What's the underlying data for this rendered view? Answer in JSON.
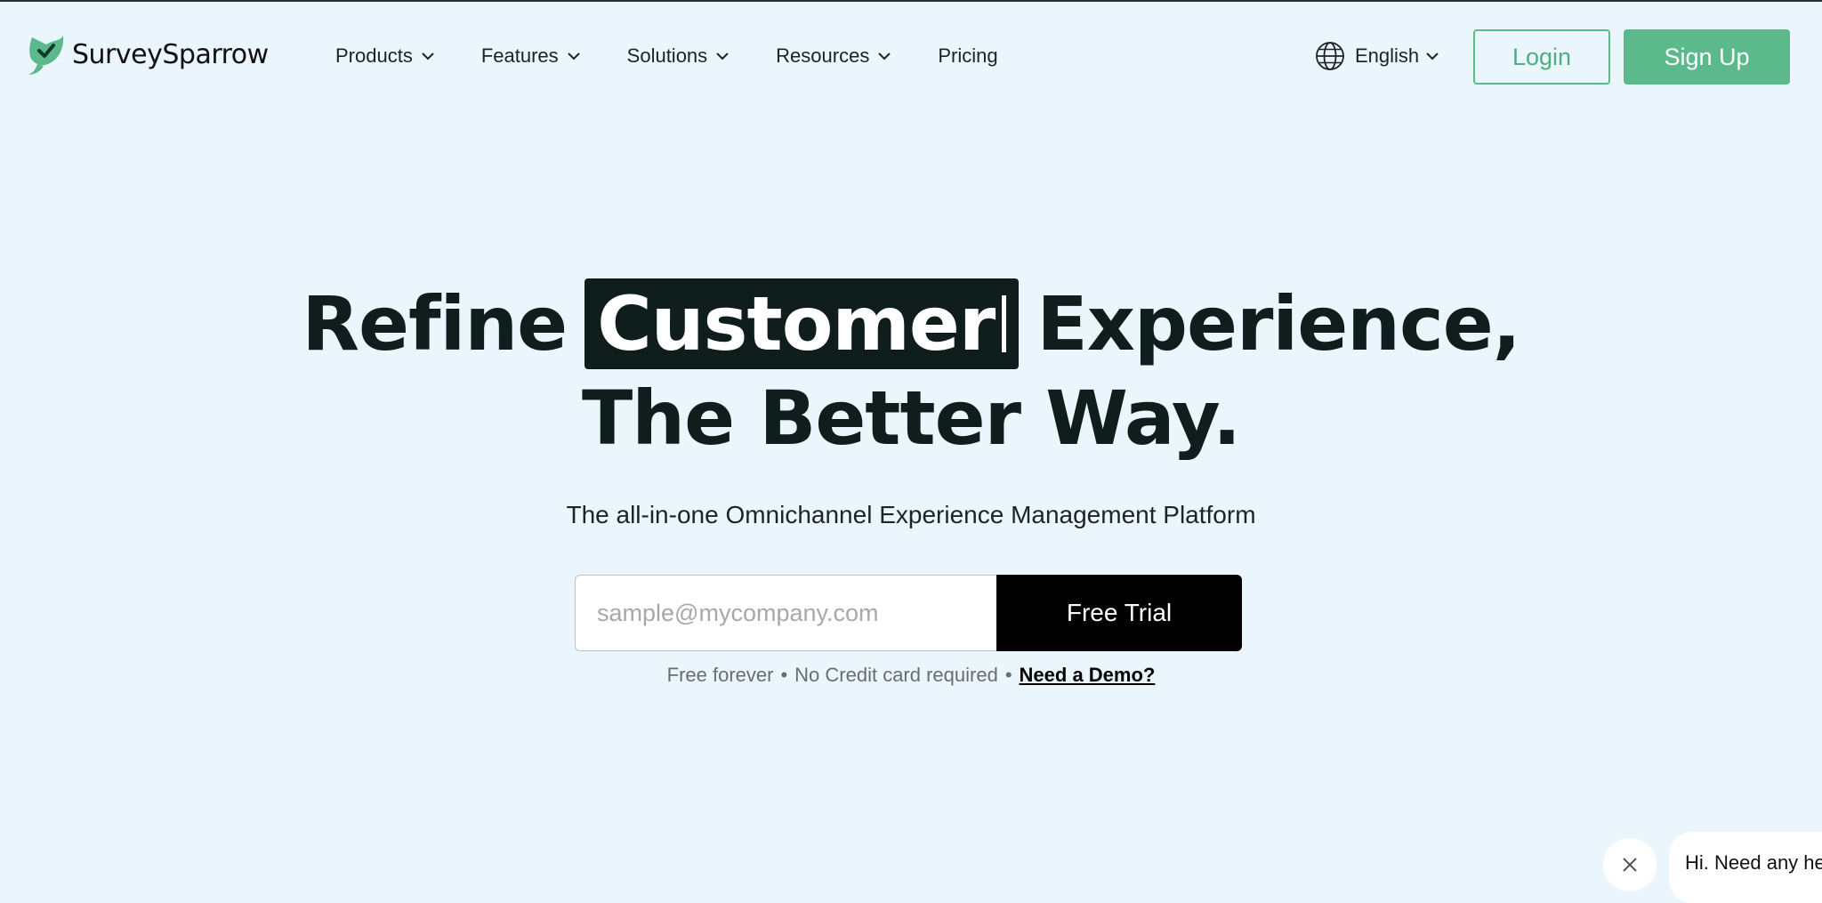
{
  "brand": {
    "name": "SurveySparrow",
    "accent": "#5bb98c",
    "dark": "#0f1d1d",
    "background": "#eaf6fc"
  },
  "nav": {
    "items": [
      {
        "label": "Products",
        "has_dropdown": true
      },
      {
        "label": "Features",
        "has_dropdown": true
      },
      {
        "label": "Solutions",
        "has_dropdown": true
      },
      {
        "label": "Resources",
        "has_dropdown": true
      },
      {
        "label": "Pricing",
        "has_dropdown": false
      }
    ]
  },
  "header": {
    "language": "English",
    "login_label": "Login",
    "signup_label": "Sign Up",
    "icons": {
      "language": "globe-icon",
      "dropdown": "chevron-down-icon"
    }
  },
  "hero": {
    "prefix": "Refine",
    "highlight": "Customer",
    "suffix": "Experience,",
    "line2": "The Better Way.",
    "subtitle": "The all-in-one Omnichannel Experience Management Platform"
  },
  "signup_form": {
    "email_placeholder": "sample@mycompany.com",
    "email_value": "",
    "button_label": "Free Trial"
  },
  "note": {
    "part1": "Free forever",
    "separator": "•",
    "part2": "No Credit card required",
    "demo_link": "Need a Demo?"
  },
  "chat": {
    "message": "Hi. Need any help?",
    "close_icon": "close-icon"
  }
}
